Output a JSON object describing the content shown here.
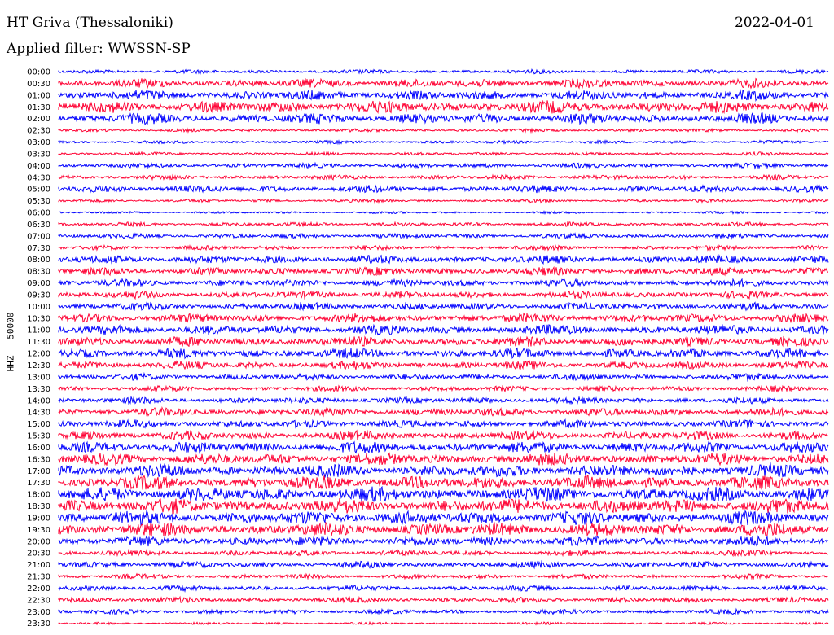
{
  "header": {
    "title": "HT Griva (Thessaloniki)",
    "date": "2022-04-01",
    "filter": "Applied filter: WWSSN-SP"
  },
  "chart_data": {
    "type": "line",
    "ylabel": "HHZ - 50000",
    "xlabel": "",
    "row_labels": [
      "00:00",
      "00:30",
      "01:00",
      "01:30",
      "02:00",
      "02:30",
      "03:00",
      "03:30",
      "04:00",
      "04:30",
      "05:00",
      "05:30",
      "06:00",
      "06:30",
      "07:00",
      "07:30",
      "08:00",
      "08:30",
      "09:00",
      "09:30",
      "10:00",
      "10:30",
      "11:00",
      "11:30",
      "12:00",
      "12:30",
      "13:00",
      "13:30",
      "14:00",
      "14:30",
      "15:00",
      "15:30",
      "16:00",
      "16:30",
      "17:00",
      "17:30",
      "18:00",
      "18:30",
      "19:00",
      "19:30",
      "20:00",
      "20:30",
      "21:00",
      "21:30",
      "22:00",
      "22:30",
      "23:00",
      "23:30"
    ],
    "series_colors": [
      "#0000ff",
      "#ff0033"
    ],
    "amplitude_level": [
      0.25,
      0.55,
      0.6,
      0.75,
      0.65,
      0.2,
      0.2,
      0.2,
      0.3,
      0.3,
      0.45,
      0.2,
      0.15,
      0.25,
      0.3,
      0.3,
      0.5,
      0.5,
      0.45,
      0.45,
      0.45,
      0.55,
      0.6,
      0.6,
      0.6,
      0.5,
      0.4,
      0.35,
      0.4,
      0.5,
      0.5,
      0.55,
      0.7,
      0.75,
      0.8,
      0.85,
      0.9,
      0.9,
      0.85,
      0.85,
      0.6,
      0.35,
      0.4,
      0.3,
      0.35,
      0.35,
      0.3,
      0.15
    ]
  }
}
